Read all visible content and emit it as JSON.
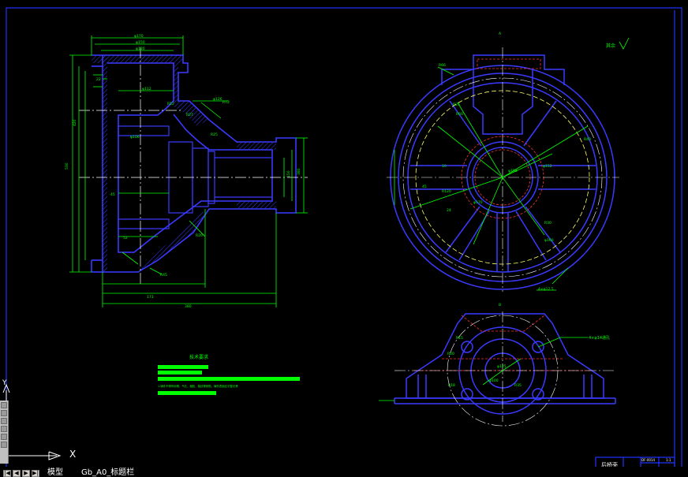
{
  "tabs": {
    "model": "模型",
    "layout": "Gb_A0_标题栏",
    "nav": [
      "|◀",
      "◀",
      "▶",
      "▶|"
    ]
  },
  "ucs": {
    "x_label": "X",
    "y_label": "Y"
  },
  "drawing": {
    "notes_title": "技术要求",
    "notes_line": "1.铸件不得有砂眼、气孔、缩松、裂纹等缺陷，铸件表面应平整光滑",
    "roughness_note": "其余",
    "titleblock_name": "后桥壳",
    "titleblock_code": "DF-0014",
    "titleblock_scale": "1:1",
    "hole_note": "4×φ14通孔",
    "label_a": "A",
    "label_b": "B",
    "dims_left": [
      "φ170",
      "φ150",
      "φ130",
      "φ112",
      "φ106",
      "φ126",
      "R12",
      "R72",
      "R27",
      "R25",
      "R20",
      "R45",
      "530",
      "420",
      "380",
      "173",
      "380",
      "150",
      "45",
      "52",
      "22"
    ],
    "dims_right": [
      "R66",
      "R25",
      "R60",
      "R40",
      "R120",
      "R30",
      "φ198",
      "φ152",
      "φ170",
      "φ160",
      "45",
      "24",
      "10",
      "4×φ12.5"
    ],
    "dims_bottom": [
      "R15",
      "R20",
      "φ125",
      "φ100",
      "R18",
      "R35"
    ]
  },
  "colors": {
    "background": "#000000",
    "frame": "#2233ff",
    "geometry": "#3a3aff",
    "dims": "#00ff00",
    "text": "#ffffff",
    "center": "#ffffff",
    "hidden": "#ff3030"
  }
}
